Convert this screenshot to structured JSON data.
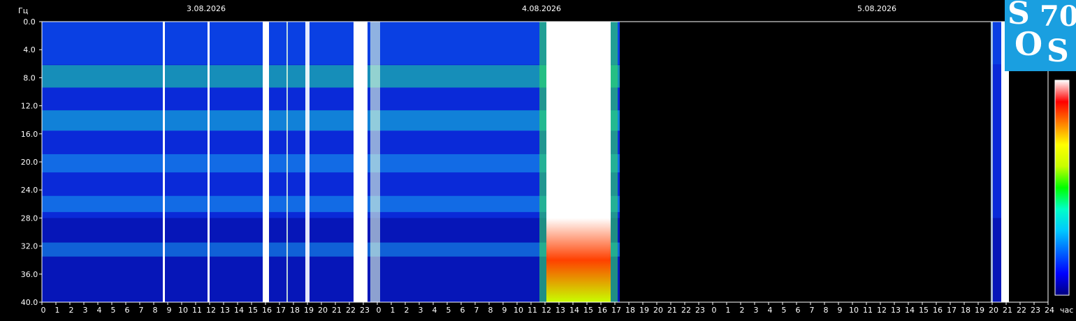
{
  "chart_data": {
    "type": "heatmap",
    "title": "",
    "y_unit_label": "Гц",
    "x_unit_label": "час",
    "ylim": [
      0,
      40
    ],
    "y_ticks": [
      "0.0",
      "4.0",
      "8.0",
      "12.0",
      "16.0",
      "20.0",
      "24.0",
      "28.0",
      "32.0",
      "36.0",
      "40.0"
    ],
    "x_range_hours": [
      0,
      72
    ],
    "x_ticks": [
      "0",
      "1",
      "2",
      "3",
      "4",
      "5",
      "6",
      "7",
      "8",
      "9",
      "10",
      "11",
      "12",
      "13",
      "14",
      "15",
      "16",
      "17",
      "18",
      "19",
      "20",
      "21",
      "22",
      "23",
      "0",
      "1",
      "2",
      "3",
      "4",
      "5",
      "6",
      "7",
      "8",
      "9",
      "10",
      "11",
      "12",
      "13",
      "14",
      "15",
      "16",
      "17",
      "18",
      "19",
      "20",
      "21",
      "22",
      "23",
      "0",
      "1",
      "2",
      "3",
      "4",
      "5",
      "6",
      "7",
      "8",
      "9",
      "10",
      "11",
      "12",
      "13",
      "14",
      "15",
      "16",
      "17",
      "18",
      "19",
      "20",
      "21",
      "22",
      "23",
      "24"
    ],
    "dates": [
      {
        "label": "3.08.2026",
        "hour": 12
      },
      {
        "label": "4.08.2026",
        "hour": 36
      },
      {
        "label": "5.08.2026",
        "hour": 60
      }
    ],
    "data_segments_hours": [
      [
        0,
        41.35
      ],
      [
        67.9,
        69.2
      ]
    ],
    "resonance_bands_hz": [
      7.8,
      14.1,
      20.2,
      26.0,
      32.5
    ],
    "bursts": [
      {
        "start_h": 8.65,
        "end_h": 8.8,
        "intensity": 1.0
      },
      {
        "start_h": 11.85,
        "end_h": 12.0,
        "intensity": 1.0
      },
      {
        "start_h": 15.8,
        "end_h": 16.25,
        "intensity": 1.0
      },
      {
        "start_h": 17.5,
        "end_h": 17.6,
        "intensity": 0.8
      },
      {
        "start_h": 18.85,
        "end_h": 19.15,
        "intensity": 0.9
      },
      {
        "start_h": 22.3,
        "end_h": 23.3,
        "intensity": 1.0
      },
      {
        "start_h": 23.5,
        "end_h": 24.2,
        "intensity": 0.6
      },
      {
        "start_h": 36.1,
        "end_h": 40.7,
        "intensity": 1.0
      },
      {
        "start_h": 67.9,
        "end_h": 68.05,
        "intensity": 0.7
      },
      {
        "start_h": 68.65,
        "end_h": 69.2,
        "intensity": 1.0
      }
    ],
    "colorbar": [
      "#000080",
      "#0000ff",
      "#0064ff",
      "#00c8ff",
      "#00ffc8",
      "#00ff00",
      "#c8ff00",
      "#ffff00",
      "#ff8000",
      "#ff0000",
      "#ffffff"
    ],
    "background_color": "#000000"
  },
  "logo": {
    "text": [
      "S",
      "70",
      "O",
      "S"
    ],
    "color": "#1a9fe0"
  }
}
